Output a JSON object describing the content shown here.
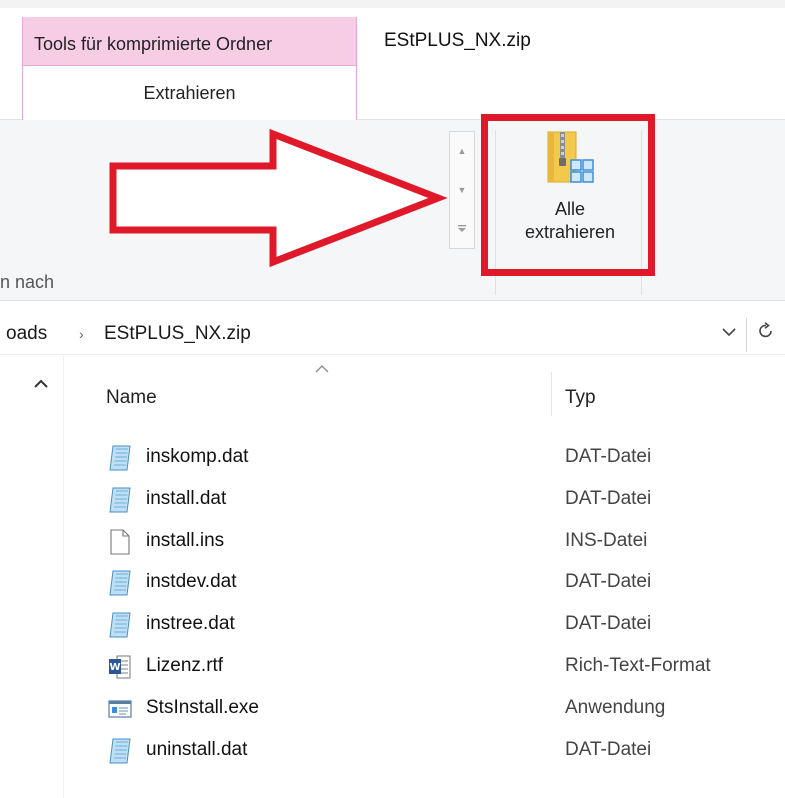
{
  "ribbon": {
    "context_group_label": "Tools für komprimierte Ordner",
    "window_title": "EStPLUS_NX.zip",
    "active_tab": "Extrahieren",
    "group_label_partial": "n nach",
    "extract_all_line1": "Alle",
    "extract_all_line2": "extrahieren"
  },
  "address": {
    "previous_partial": "oads",
    "separator": "›",
    "current": "EStPLUS_NX.zip"
  },
  "columns": {
    "name": "Name",
    "type": "Typ"
  },
  "files": [
    {
      "name": "inskomp.dat",
      "type": "DAT-Datei",
      "icon": "dat-file-icon"
    },
    {
      "name": "install.dat",
      "type": "DAT-Datei",
      "icon": "dat-file-icon"
    },
    {
      "name": "install.ins",
      "type": "INS-Datei",
      "icon": "blank-file-icon"
    },
    {
      "name": "instdev.dat",
      "type": "DAT-Datei",
      "icon": "dat-file-icon"
    },
    {
      "name": "instree.dat",
      "type": "DAT-Datei",
      "icon": "dat-file-icon"
    },
    {
      "name": "Lizenz.rtf",
      "type": "Rich-Text-Format",
      "icon": "word-document-icon"
    },
    {
      "name": "StsInstall.exe",
      "type": "Anwendung",
      "icon": "application-icon"
    },
    {
      "name": "uninstall.dat",
      "type": "DAT-Datei",
      "icon": "dat-file-icon"
    }
  ],
  "colors": {
    "context_pink": "#f7cde6",
    "annotation_red": "#e0192a",
    "ribbon_bg": "#f5f6f7"
  }
}
